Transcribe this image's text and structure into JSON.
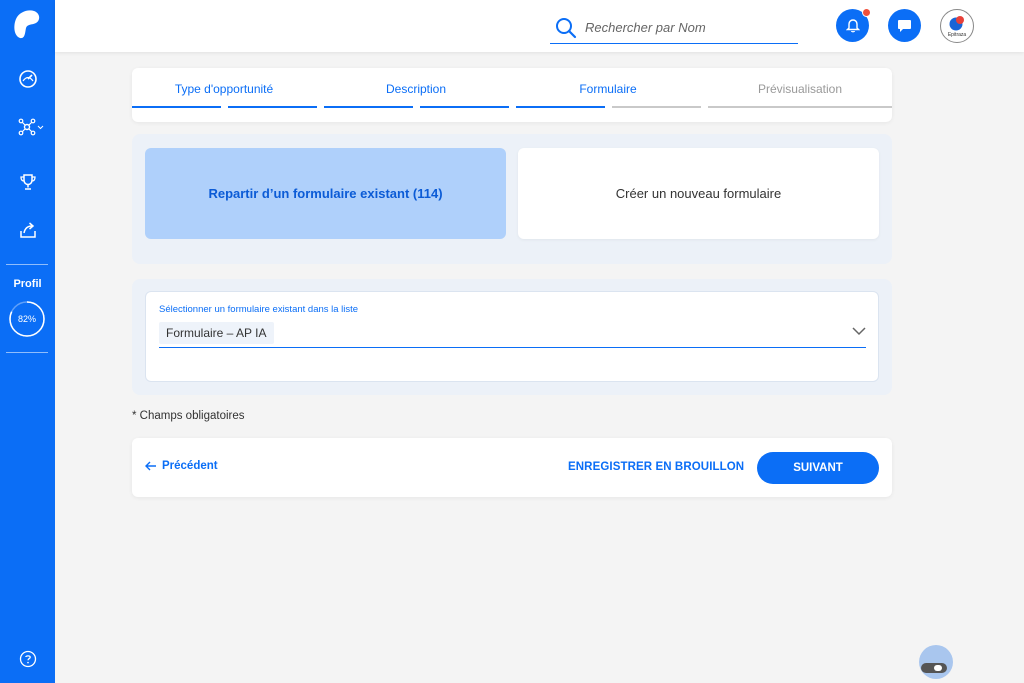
{
  "search": {
    "placeholder": "Rechercher par Nom"
  },
  "avatar": {
    "caption": "Epitraza"
  },
  "sidebar": {
    "profile_label": "Profil",
    "profile_progress": "82%",
    "profile_progress_value": 0.82
  },
  "stepper": {
    "steps": [
      {
        "label": "Type d'opportunité",
        "state": "done"
      },
      {
        "label": "Description",
        "state": "done"
      },
      {
        "label": "Formulaire",
        "state": "active"
      },
      {
        "label": "Prévisualisation",
        "state": "pending"
      }
    ]
  },
  "choices": {
    "existing_label": "Repartir d’un formulaire existant (114)",
    "new_label": "Créer un nouveau formulaire"
  },
  "select": {
    "label": "Sélectionner un formulaire existant dans la liste",
    "value": "Formulaire – AP IA"
  },
  "required_note": "* Champs obligatoires",
  "actions": {
    "previous": "Précédent",
    "draft": "ENREGISTRER EN BROUILLON",
    "next": "SUIVANT"
  },
  "colors": {
    "primary": "#0b6ef6",
    "selected_card": "#afd0fb",
    "notification": "#f0503c"
  }
}
